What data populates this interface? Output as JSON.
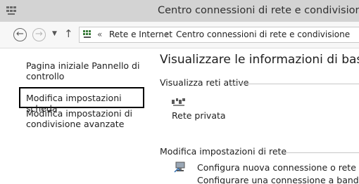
{
  "window": {
    "title": "Centro connessioni di rete e condivisione",
    "app_icon": "network-grid-icon"
  },
  "navigation": {
    "back_icon": "back-arrow-icon",
    "forward_icon": "forward-arrow-icon",
    "recent_icon": "chevron-down-icon",
    "up_icon": "up-arrow-icon",
    "breadcrumb": {
      "separator_overflow": "«",
      "items": [
        "Rete e Internet",
        "Centro connessioni di rete e condivisione"
      ],
      "separator": "›"
    }
  },
  "sidebar": {
    "items": [
      {
        "label": "Pagina iniziale Pannello di\ncontrollo"
      },
      {
        "label": "Modifica impostazioni scheda"
      },
      {
        "label": "Modifica impostazioni di\ncondivisione avanzate"
      }
    ]
  },
  "main": {
    "heading": "Visualizzare le informazioni di base sulla re",
    "active_networks": {
      "label": "Visualizza reti attive",
      "network_icon": "network-icon",
      "network_name": "Rete privata"
    },
    "change_settings": {
      "label": "Modifica impostazioni di rete",
      "tasks": [
        {
          "icon": "new-connection-icon",
          "link": "Configura nuova connessione o rete",
          "description": "Configurare una connessione a banda larga, r"
        }
      ]
    }
  }
}
